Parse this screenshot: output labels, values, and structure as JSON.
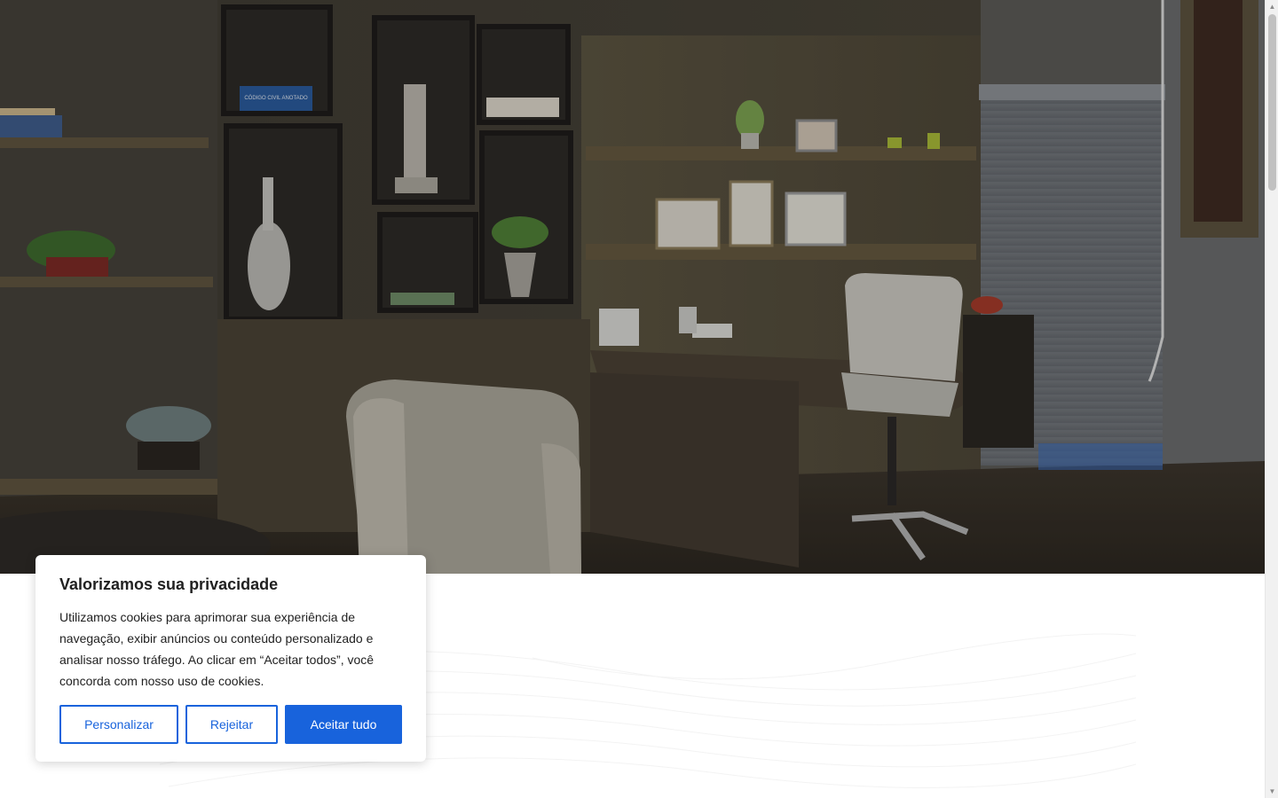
{
  "cookie_banner": {
    "title": "Valorizamos sua privacidade",
    "text": "Utilizamos cookies para aprimorar sua experiência de navegação, exibir anúncios ou conteúdo personalizado e analisar nosso tráfego. Ao clicar em “Aceitar todos”, você concorda com nosso uso de cookies.",
    "buttons": {
      "customize": "Personalizar",
      "reject": "Rejeitar",
      "accept": "Aceitar tudo"
    }
  },
  "hero": {
    "book_spine_text": "CÓDIGO CIVIL ANOTADO"
  },
  "colors": {
    "accent": "#1863dc",
    "title_text": "#212121",
    "hero_dark": "#3a352d"
  },
  "icons": {
    "scroll_up": "triangle-up-icon",
    "scroll_down": "triangle-down-icon"
  }
}
